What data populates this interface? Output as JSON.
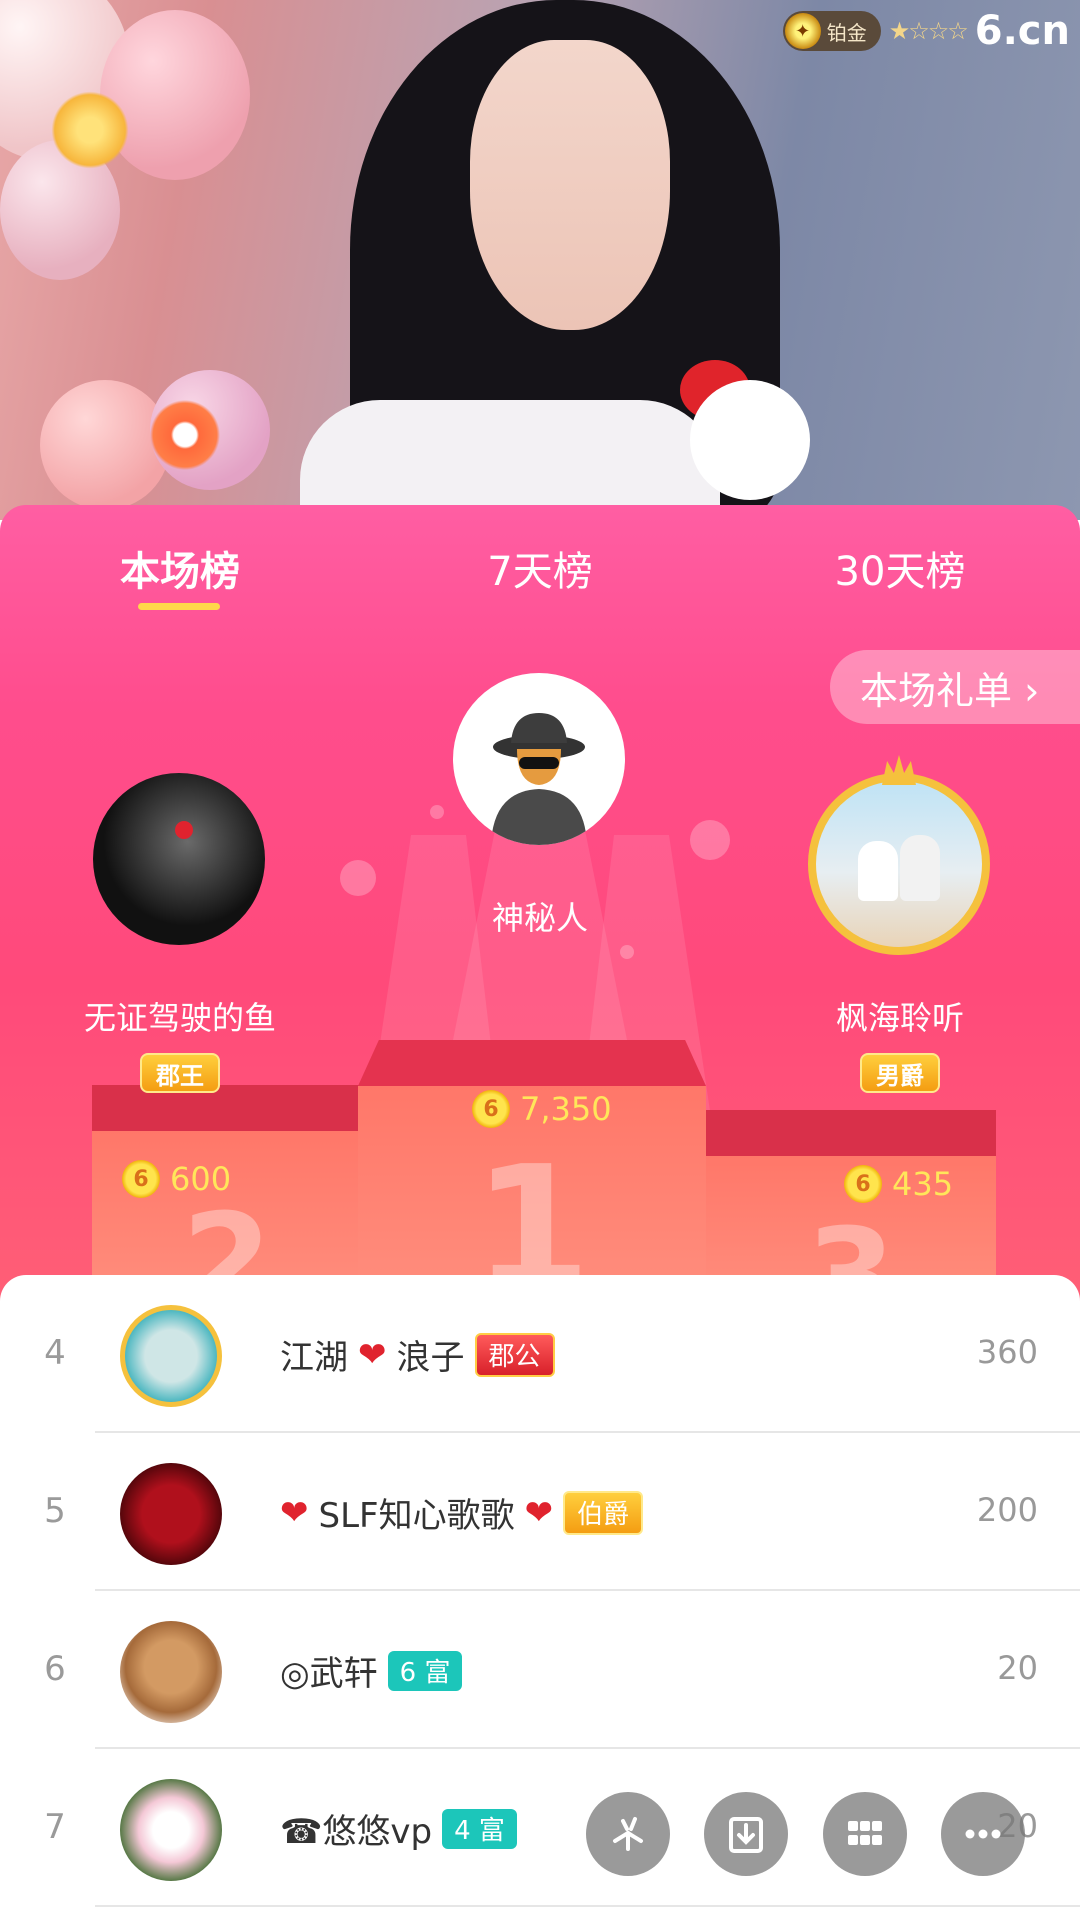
{
  "watermark": {
    "badge_label": "铂金",
    "stars": "★☆☆☆",
    "brand": "6.cn"
  },
  "tabs": [
    {
      "label": "本场榜",
      "active": true
    },
    {
      "label": "7天榜",
      "active": false
    },
    {
      "label": "30天榜",
      "active": false
    }
  ],
  "gift_list_button": "本场礼单 ›",
  "podium": {
    "first": {
      "name": "神秘人",
      "coins": "7,350",
      "place": "1"
    },
    "second": {
      "name": "无证驾驶的鱼",
      "title": "郡王",
      "coins": "600",
      "place": "2"
    },
    "third": {
      "name": "枫海聆听",
      "title": "男爵",
      "coins": "435",
      "place": "3"
    }
  },
  "coin_glyph": "6",
  "rows": [
    {
      "rank": "4",
      "name_parts": [
        "江湖",
        "❤",
        "浪子"
      ],
      "badge": "郡公",
      "badge_style": "red",
      "score": "360"
    },
    {
      "rank": "5",
      "name_parts": [
        "❤",
        "SLF知心歌歌",
        "❤"
      ],
      "badge": "伯爵",
      "badge_style": "gold",
      "score": "200"
    },
    {
      "rank": "6",
      "name": "◎武轩",
      "badge": "6 富",
      "badge_style": "teal",
      "score": "20"
    },
    {
      "rank": "7",
      "name": "☎悠悠vp",
      "badge": "4 富",
      "badge_style": "teal",
      "score": "20"
    }
  ],
  "fabs": [
    "share-icon",
    "download-icon",
    "grid-icon",
    "more-icon"
  ],
  "colors": {
    "accent_pink": "#ff4d8d",
    "gold": "#ffe65a",
    "teal": "#1cc6ba"
  }
}
